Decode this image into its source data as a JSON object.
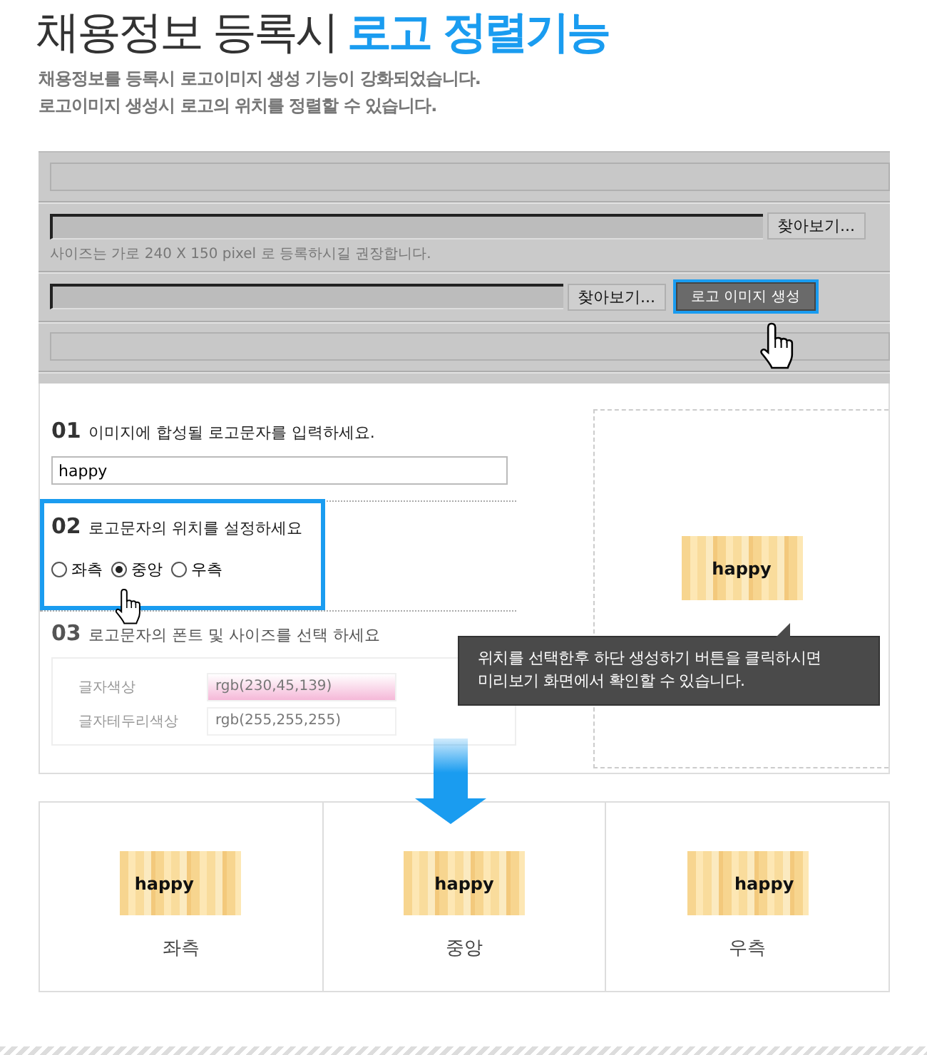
{
  "heading": {
    "plain": "채용정보 등록시",
    "highlight": "로고 정렬기능"
  },
  "description": [
    "채용정보를 등록시 로고이미지 생성 기능이 강화되었습니다.",
    "로고이미지 생성시 로고의 위치를 정렬할 수 있습니다."
  ],
  "upload_panel": {
    "browse_label": "찾아보기...",
    "browse_label_2": "찾아보기...",
    "hint": "사이즈는 가로 240 X 150 pixel 로 등록하시길 권장합니다.",
    "generate_button": "로고 이미지 생성"
  },
  "step1": {
    "number": "01",
    "label": "이미지에 합성될 로고문자를 입력하세요.",
    "value": "happy"
  },
  "step2": {
    "number": "02",
    "label": "로고문자의 위치를 설정하세요",
    "options": [
      {
        "label": "좌측",
        "selected": false
      },
      {
        "label": "중앙",
        "selected": true
      },
      {
        "label": "우측",
        "selected": false
      }
    ]
  },
  "step3": {
    "number": "03",
    "label": "로고문자의 폰트 및 사이즈를 선택 하세요",
    "fields": [
      {
        "label": "글자색상",
        "value": "rgb(230,45,139)",
        "color": "#f5b8d8"
      },
      {
        "label": "글자테두리색상",
        "value": "rgb(255,255,255)",
        "color": "#ffffff"
      }
    ]
  },
  "preview": {
    "logo_text": "happy",
    "kind": "center"
  },
  "tooltip": [
    "위치를 선택한후 하단 생성하기 버튼을 클릭하시면",
    "미리보기 화면에서 확인할 수 있습니다."
  ],
  "results": [
    {
      "logo_text": "happy",
      "kind": "left",
      "label": "좌측"
    },
    {
      "logo_text": "happy",
      "kind": "center",
      "label": "중앙"
    },
    {
      "logo_text": "happy",
      "kind": "right",
      "label": "우측"
    }
  ]
}
